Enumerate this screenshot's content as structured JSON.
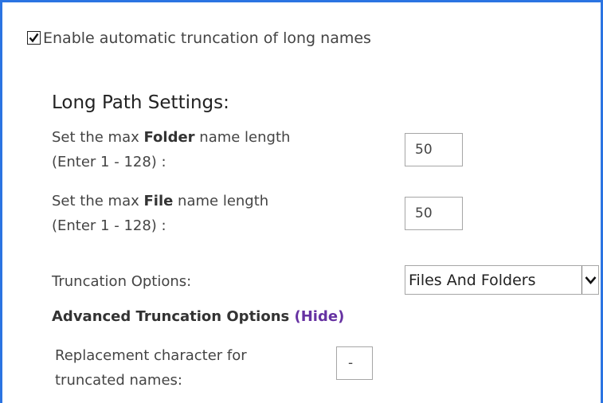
{
  "truncation": {
    "enable_checked": true,
    "enable_label": "Enable automatic truncation of long names"
  },
  "long_path": {
    "title": "Long Path Settings:",
    "folder": {
      "label_prefix": "Set the max ",
      "label_bold": "Folder",
      "label_suffix": " name length",
      "label_range": "(Enter 1 - 128) :",
      "value": "50"
    },
    "file": {
      "label_prefix": "Set the max ",
      "label_bold": "File",
      "label_suffix": " name length",
      "label_range": "(Enter 1 - 128) :",
      "value": "50"
    },
    "options": {
      "label": "Truncation Options:",
      "selected": "Files And Folders"
    }
  },
  "advanced": {
    "title": "Advanced Truncation Options ",
    "toggle_link": "(Hide)",
    "replacement": {
      "label_line1": "Replacement character for",
      "label_line2": "truncated names:",
      "value": "-"
    }
  },
  "icons": {
    "checkmark": "checkmark-icon",
    "dropdown": "chevron-down-icon"
  },
  "colors": {
    "frame_border": "#2b74e2",
    "link": "#6632a2"
  }
}
